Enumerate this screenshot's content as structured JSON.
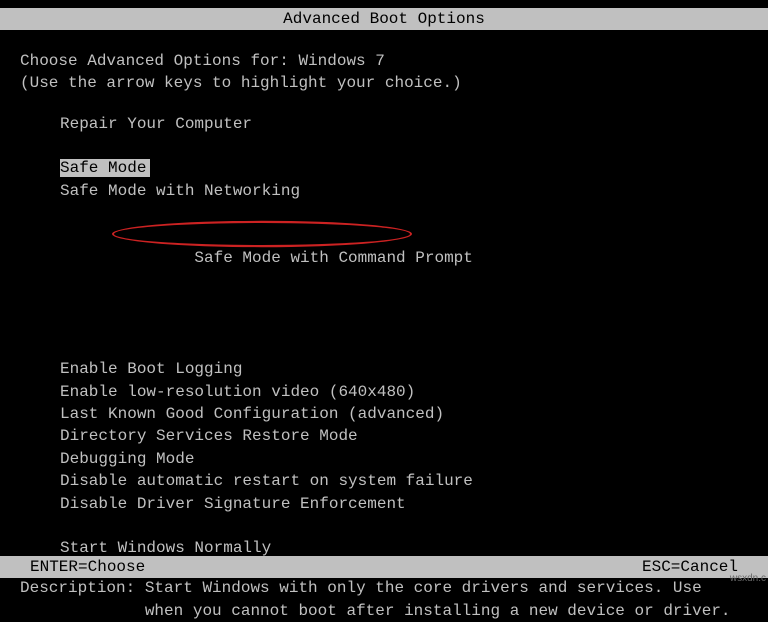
{
  "title": "Advanced Boot Options",
  "header": {
    "line1": "Choose Advanced Options for: Windows 7",
    "line2": "(Use the arrow keys to highlight your choice.)"
  },
  "menu": {
    "repair": "Repair Your Computer",
    "safe_mode": "Safe Mode",
    "safe_mode_net": "Safe Mode with Networking",
    "safe_mode_cmd": "Safe Mode with Command Prompt",
    "boot_logging": "Enable Boot Logging",
    "low_res": "Enable low-resolution video (640x480)",
    "last_known": "Last Known Good Configuration (advanced)",
    "ds_restore": "Directory Services Restore Mode",
    "debugging": "Debugging Mode",
    "disable_restart": "Disable automatic restart on system failure",
    "disable_sig": "Disable Driver Signature Enforcement",
    "start_normal": "Start Windows Normally"
  },
  "description": {
    "label": "Description: ",
    "text": "Start Windows with only the core drivers and services. Use\n             when you cannot boot after installing a new device or driver."
  },
  "footer": {
    "enter": "ENTER=Choose",
    "esc": "ESC=Cancel"
  },
  "watermark": "wsxdn.c"
}
